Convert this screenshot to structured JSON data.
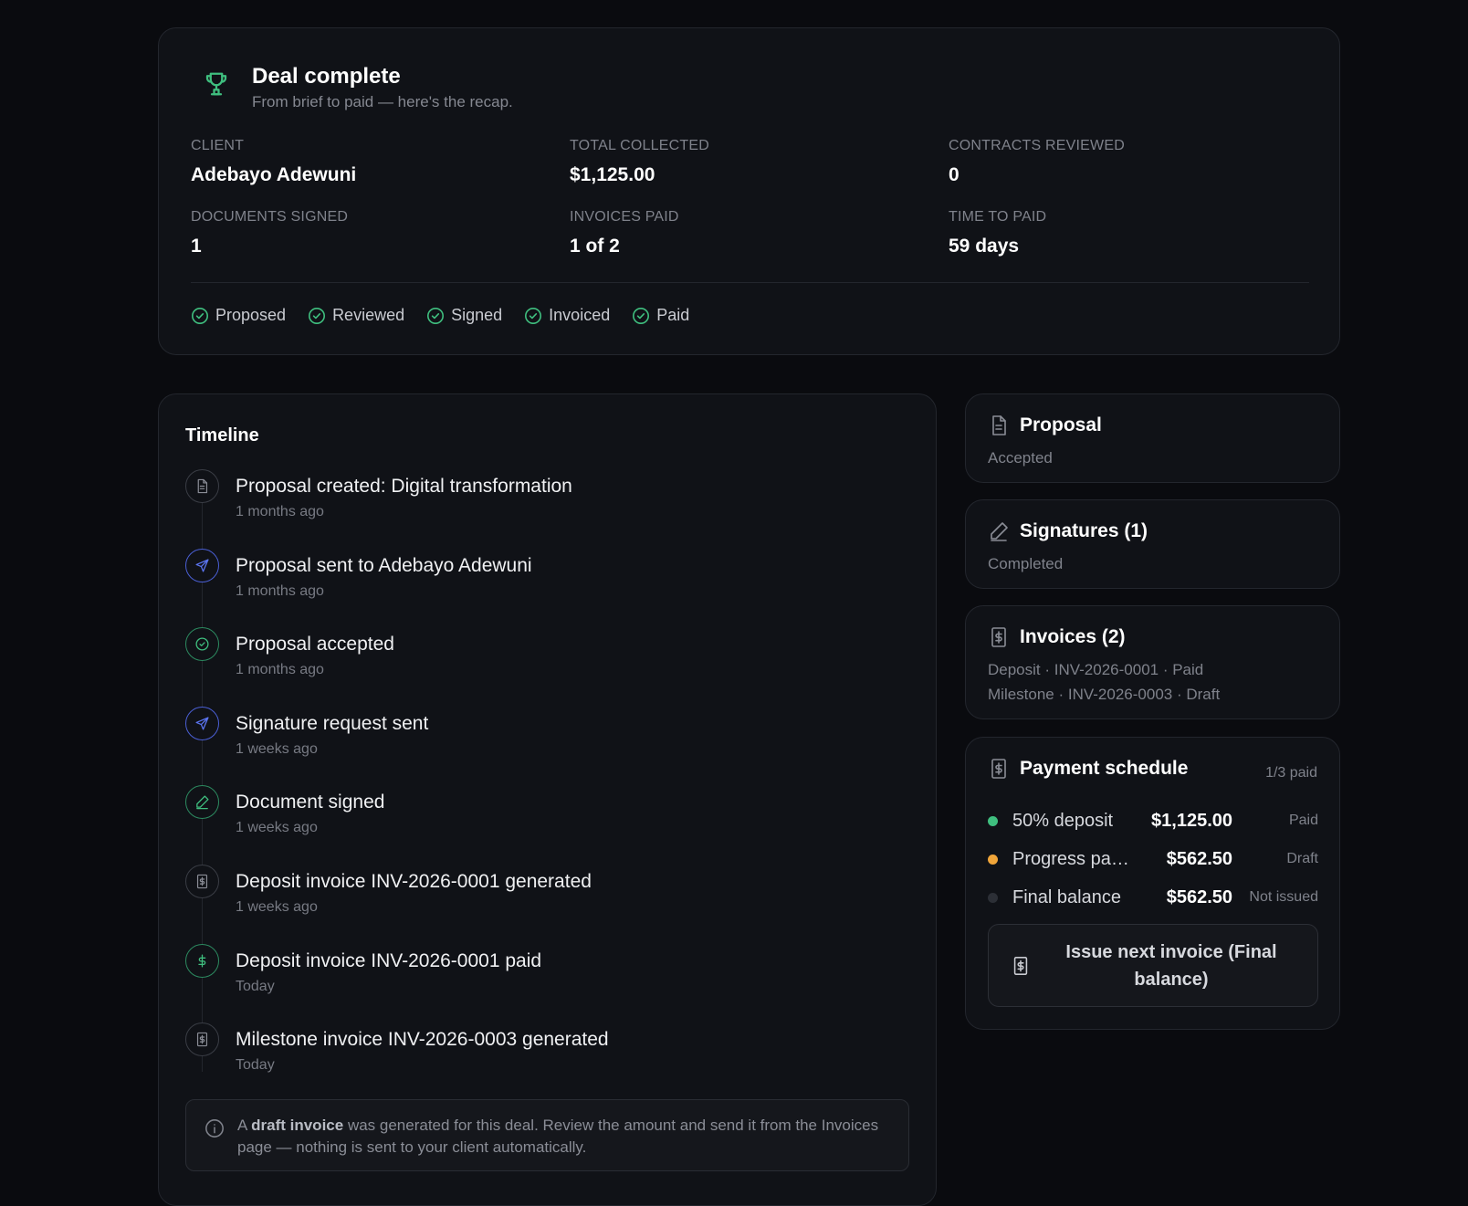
{
  "summary": {
    "title": "Deal complete",
    "subtitle": "From brief to paid — here's the recap.",
    "icon": "trophy-icon",
    "stats": [
      {
        "label": "CLIENT",
        "value": "Adebayo Adewuni"
      },
      {
        "label": "TOTAL COLLECTED",
        "value": "$1,125.00"
      },
      {
        "label": "CONTRACTS REVIEWED",
        "value": "0"
      },
      {
        "label": "DOCUMENTS SIGNED",
        "value": "1"
      },
      {
        "label": "INVOICES PAID",
        "value": "1 of 2"
      },
      {
        "label": "TIME TO PAID",
        "value": "59 days"
      }
    ],
    "stages": [
      "Proposed",
      "Reviewed",
      "Signed",
      "Invoiced",
      "Paid"
    ]
  },
  "timeline": {
    "title": "Timeline",
    "events": [
      {
        "text": "Proposal created: Digital transformation",
        "time": "1 months ago",
        "icon": "document-icon"
      },
      {
        "text": "Proposal sent to Adebayo Adewuni",
        "time": "1 months ago",
        "icon": "send-icon"
      },
      {
        "text": "Proposal accepted",
        "time": "1 months ago",
        "icon": "check-circle-icon"
      },
      {
        "text": "Signature request sent",
        "time": "1 weeks ago",
        "icon": "send-icon"
      },
      {
        "text": "Document signed",
        "time": "1 weeks ago",
        "icon": "pen-icon"
      },
      {
        "text": "Deposit invoice INV-2026-0001 generated",
        "time": "1 weeks ago",
        "icon": "invoice-icon"
      },
      {
        "text": "Deposit invoice INV-2026-0001 paid",
        "time": "Today",
        "icon": "dollar-icon"
      },
      {
        "text": "Milestone invoice INV-2026-0003 generated",
        "time": "Today",
        "icon": "invoice-icon"
      }
    ],
    "note": {
      "prefix": "A ",
      "bold": "draft invoice",
      "rest": " was generated for this deal. Review the amount and send it from the Invoices page — nothing is sent to your client automatically."
    }
  },
  "proposal": {
    "title": "Proposal",
    "status": "Accepted"
  },
  "signatures": {
    "title": "Signatures (1)",
    "status": "Completed"
  },
  "invoices": {
    "title": "Invoices (2)",
    "lines": [
      "Deposit · INV-2026-0001 · Paid",
      "Milestone · INV-2026-0003 · Draft"
    ]
  },
  "payment": {
    "title": "Payment schedule",
    "count": "1/3 paid",
    "rows": [
      {
        "name": "50% deposit",
        "amount": "$1,125.00",
        "status": "Paid",
        "color": "#3fbf7f"
      },
      {
        "name": "Progress payment",
        "amount": "$562.50",
        "status": "Draft",
        "color": "#f0a53a"
      },
      {
        "name": "Final balance",
        "amount": "$562.50",
        "status": "Not issued",
        "color": "#2c2f36"
      }
    ],
    "button": "Issue next invoice (Final balance)"
  },
  "colors": {
    "accent_green": "#3fbf7f",
    "accent_blue": "#5b74f0",
    "draft_orange": "#f0a53a"
  }
}
